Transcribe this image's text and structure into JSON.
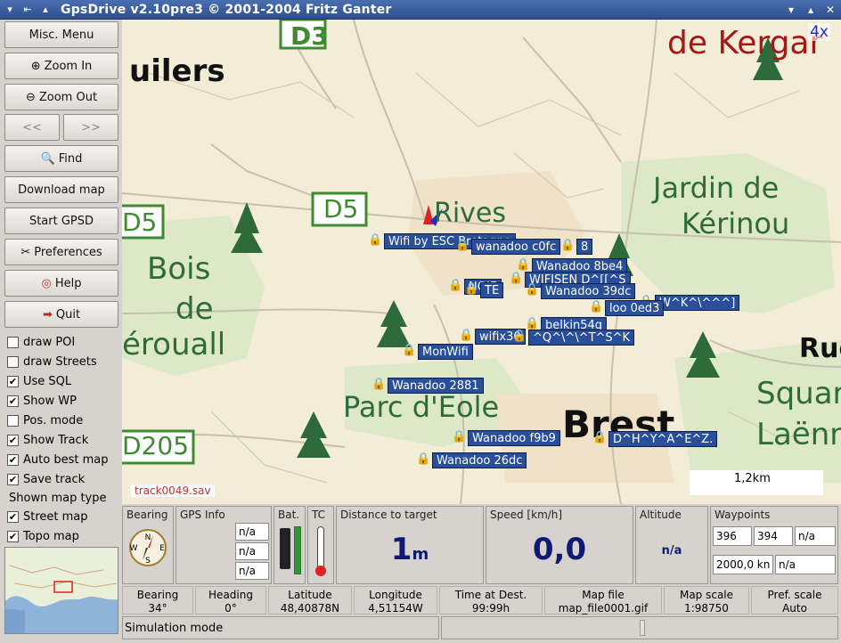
{
  "window": {
    "title": "GpsDrive v2.10pre3  © 2001-2004 Fritz Ganter"
  },
  "sidebar": {
    "buttons": {
      "misc_menu": "Misc. Menu",
      "zoom_in": "Zoom In",
      "zoom_out": "Zoom Out",
      "prev": "<<",
      "next": ">>",
      "find": "Find",
      "download_map": "Download map",
      "start_gpsd": "Start GPSD",
      "preferences": "Preferences",
      "help": "Help",
      "quit": "Quit"
    },
    "checks": [
      {
        "label": "draw POI",
        "checked": false
      },
      {
        "label": "draw Streets",
        "checked": false
      },
      {
        "label": "Use SQL",
        "checked": true
      },
      {
        "label": "Show WP",
        "checked": true
      },
      {
        "label": "Pos. mode",
        "checked": false
      },
      {
        "label": "Show Track",
        "checked": true
      },
      {
        "label": "Auto best map",
        "checked": true
      },
      {
        "label": "Save track",
        "checked": true
      }
    ],
    "map_type_title": "Shown map type",
    "map_types": [
      {
        "label": "Street map",
        "checked": true
      },
      {
        "label": "Topo map",
        "checked": true
      }
    ]
  },
  "map": {
    "zoom": "4x",
    "track_file": "track0049.sav",
    "scale_text": "1,2km",
    "labels": {
      "road_d3": "D3",
      "road_d5a": "D5",
      "road_d5b": "D5",
      "road_d205": "D205",
      "place_uilers": "uilers",
      "place_kergar": "de Kergar",
      "place_jardin": "Jardin de",
      "place_kerinou": "Kérinou",
      "place_bois": "Bois",
      "place_de": "de",
      "place_eroual": "érouall",
      "place_rives": "Rives",
      "place_parc": "Parc d'Eole",
      "place_brest": "Brest",
      "place_square": "Squar",
      "place_laenn": "Laënr",
      "place_ru": "Rue"
    },
    "waypoints": [
      "Wifi by ESC Bretagne",
      "wanadoo c0fc",
      "Wanadoo 8be4",
      "WIFISEN D^[[^S",
      "Wanadoo 39dc",
      "W^K^\\^^^]",
      "loo 0ed3",
      "belkin54g",
      "wifix30",
      "^Q^\\^\\^T^S^K",
      "MonWifi",
      "Wanadoo 2881",
      "Wanadoo f9b9",
      "D^H^Y^A^E^Z.",
      "Wanadoo 26dc",
      "NOIE",
      "TE",
      "8"
    ]
  },
  "panel": {
    "bearing_title": "Bearing",
    "gps_info_title": "GPS Info",
    "gps_info_values": [
      "n/a",
      "n/a",
      "n/a"
    ],
    "bat_title": "Bat.",
    "tc_title": "TC",
    "distance_title": "Distance to target",
    "distance_value": "1",
    "distance_unit": "m",
    "speed_title": "Speed [km/h]",
    "speed_value": "0,0",
    "altitude_title": "Altitude",
    "altitude_value": "n/a",
    "waypoints_title": "Waypoints",
    "waypoints_fields": [
      "396",
      "394",
      "n/a",
      "2000,0 kn",
      "n/a"
    ]
  },
  "stats": [
    {
      "label": "Bearing",
      "value": "34°"
    },
    {
      "label": "Heading",
      "value": "0°"
    },
    {
      "label": "Latitude",
      "value": "48,40878N"
    },
    {
      "label": "Longitude",
      "value": "4,51154W"
    },
    {
      "label": "Time at Dest.",
      "value": "99:99h"
    },
    {
      "label": "Map file",
      "value": "map_file0001.gif"
    },
    {
      "label": "Map scale",
      "value": "1:98750"
    },
    {
      "label": "Pref. scale",
      "value": "Auto"
    }
  ],
  "status": {
    "text": "Simulation mode"
  },
  "colors": {
    "title_bar": "#3b5c9c",
    "waypoint_bg": "#2a4f9a",
    "big_value": "#0f1a75",
    "map_bg": "#f3ecd7"
  }
}
